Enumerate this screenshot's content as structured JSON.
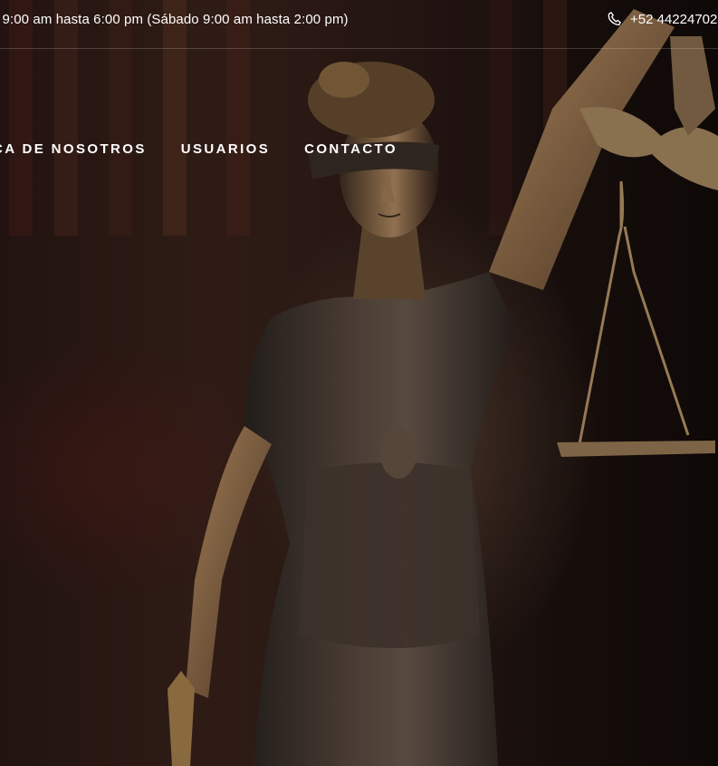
{
  "topbar": {
    "hours": ": 9:00 am hasta 6:00 pm (Sábado 9:00 am hasta 2:00 pm)",
    "phone": "+52 44224702",
    "phone_icon": "phone-icon"
  },
  "nav": {
    "items": [
      {
        "label": "CA DE NOSOTROS"
      },
      {
        "label": "USUARIOS"
      },
      {
        "label": "CONTACTO"
      }
    ]
  },
  "hero": {
    "image_subject": "Bronze Lady Justice statue, blindfolded, holding scales",
    "colors": {
      "bronze": "#8a6a4a",
      "shadow": "#1a100c",
      "highlight": "#d4b08a"
    }
  }
}
